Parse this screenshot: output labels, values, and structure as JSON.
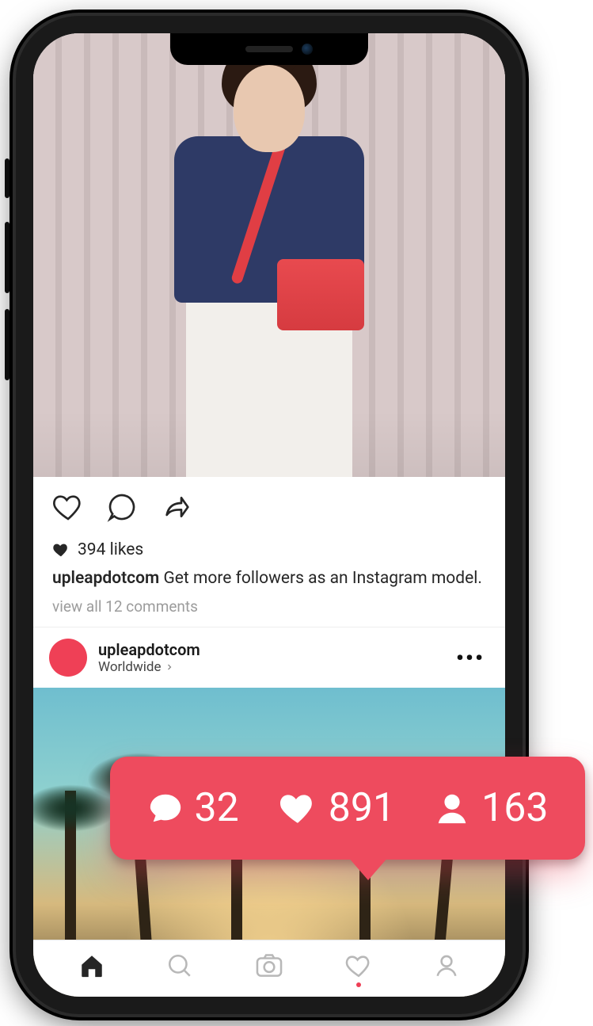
{
  "post1": {
    "likes_count": "394 likes",
    "username": "upleapdotcom",
    "caption": "Get more followers as an Instagram model.",
    "view_comments": "view all 12 comments"
  },
  "post2": {
    "username": "upleapdotcom",
    "location": "Worldwide"
  },
  "notification": {
    "comments": "32",
    "likes": "891",
    "followers": "163"
  },
  "colors": {
    "accent": "#ee4b5e"
  }
}
